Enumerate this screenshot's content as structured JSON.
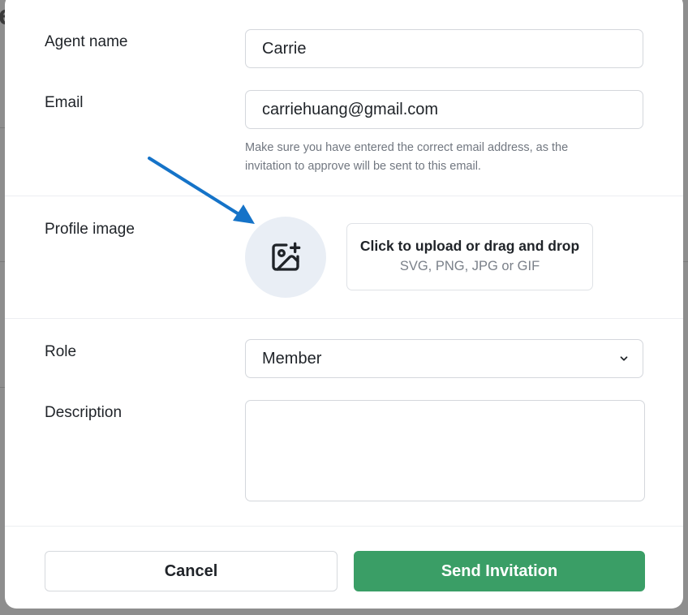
{
  "form": {
    "agent_name_label": "Agent name",
    "agent_name_value": "Carrie",
    "email_label": "Email",
    "email_value": "carriehuang@gmail.com",
    "email_helper_line1": "Make sure you have entered the correct email address, as the",
    "email_helper_line2": "invitation to approve will be sent to this email.",
    "profile_image_label": "Profile image",
    "upload_title": "Click to upload or drag and drop",
    "upload_subtitle": "SVG, PNG, JPG or GIF",
    "role_label": "Role",
    "role_value": "Member",
    "description_label": "Description",
    "description_value": ""
  },
  "footer": {
    "cancel_label": "Cancel",
    "send_label": "Send Invitation"
  },
  "icons": {
    "avatar": "image-plus-icon",
    "role_dropdown": "chevron-down-icon",
    "annotation": "arrow-icon"
  },
  "colors": {
    "primary": "#3a9e66",
    "annotation_arrow": "#1573c8",
    "avatar_bg": "#e9eef5"
  }
}
